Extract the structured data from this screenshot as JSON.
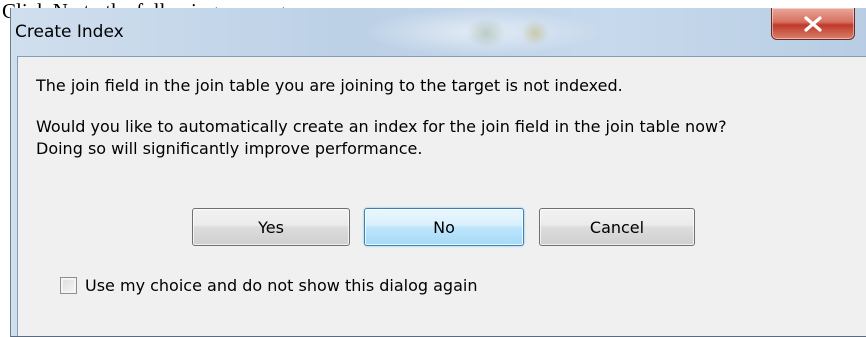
{
  "page_caption": "Click No to the following message:",
  "dialog": {
    "title": "Create Index",
    "close_icon": "close-x-icon",
    "message_line1": "The join field in the join table you are joining to the target is not indexed.",
    "message_line2": "Would you like to automatically create an index for the join field in the join table now?",
    "message_line3": "Doing so will significantly improve performance.",
    "buttons": {
      "yes": "Yes",
      "no": "No",
      "cancel": "Cancel"
    },
    "checkbox": {
      "label": "Use my choice and do not show this dialog again",
      "checked": false
    }
  },
  "colors": {
    "close_button": "#c0392b",
    "default_button_border": "#3c7fb1",
    "frame": "#c7d9ec",
    "client_area": "#f0f0f0"
  }
}
